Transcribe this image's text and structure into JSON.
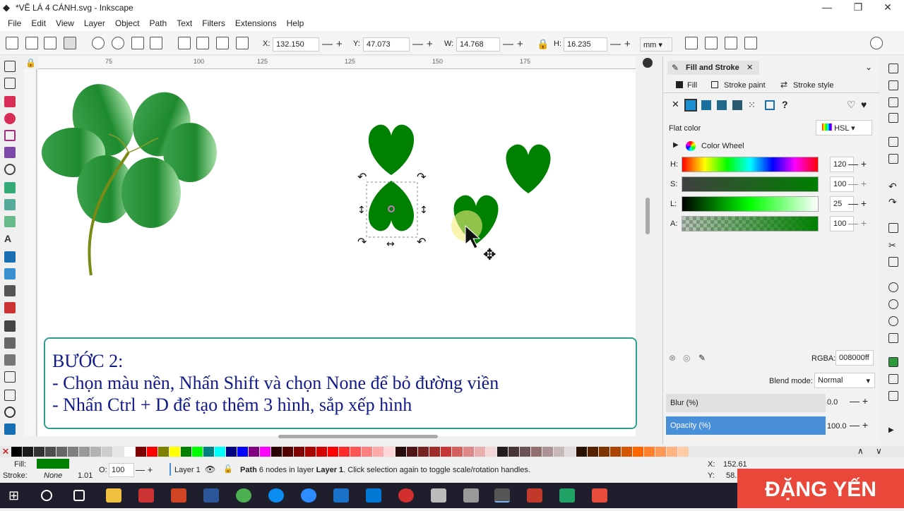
{
  "window": {
    "title": "*VẼ LÁ 4 CÁNH.svg - Inkscape",
    "minimize": "—",
    "maximize": "❐",
    "close": "✕"
  },
  "menu": [
    "File",
    "Edit",
    "View",
    "Layer",
    "Object",
    "Path",
    "Text",
    "Filters",
    "Extensions",
    "Help"
  ],
  "toolbar": {
    "x_label": "X:",
    "x_value": "132.150",
    "y_label": "Y:",
    "y_value": "47.073",
    "w_label": "W:",
    "w_value": "14.768",
    "h_label": "H:",
    "h_value": "16.235",
    "unit": "mm"
  },
  "ruler_top": [
    "75",
    "100",
    "125",
    "150",
    "175"
  ],
  "caption": {
    "line1": "BƯỚC 2:",
    "line2": "- Chọn màu nền, Nhấn Shift và chọn None để bỏ đường viền",
    "line3": "- Nhấn Ctrl + D để tạo thêm 3 hình, sắp xếp hình"
  },
  "panel": {
    "tab_title": "Fill and Stroke",
    "tabs": [
      "Fill",
      "Stroke paint",
      "Stroke style"
    ],
    "flat_color": "Flat color",
    "mode": "HSL",
    "color_wheel": "Color Wheel",
    "sliders": [
      {
        "label": "H:",
        "value": "120"
      },
      {
        "label": "S:",
        "value": "100"
      },
      {
        "label": "L:",
        "value": "25"
      },
      {
        "label": "A:",
        "value": "100"
      }
    ],
    "rgba_label": "RGBA:",
    "rgba_value": "008000ff",
    "blend_label": "Blend mode:",
    "blend_value": "Normal",
    "blur_label": "Blur (%)",
    "blur_value": "0.0",
    "opacity_label": "Opacity (%)",
    "opacity_value": "100.0"
  },
  "status": {
    "fill_label": "Fill:",
    "stroke_label": "Stroke:",
    "stroke_value": "None",
    "stroke_width": "1.01",
    "o_label": "O:",
    "o_value": "100",
    "layer": "Layer 1",
    "message_bold": "Path",
    "message_mid": " 6 nodes in layer ",
    "message_layer": "Layer 1",
    "message_end": ". Click selection again to toggle scale/rotation handles.",
    "cx_label": "X:",
    "cx_value": "152.61",
    "cy_label": "Y:",
    "cy_value": "58."
  },
  "watermark": "ĐẶNG YẾN",
  "colors": {
    "fill": "#008000",
    "accent": "#2e9f8f"
  }
}
